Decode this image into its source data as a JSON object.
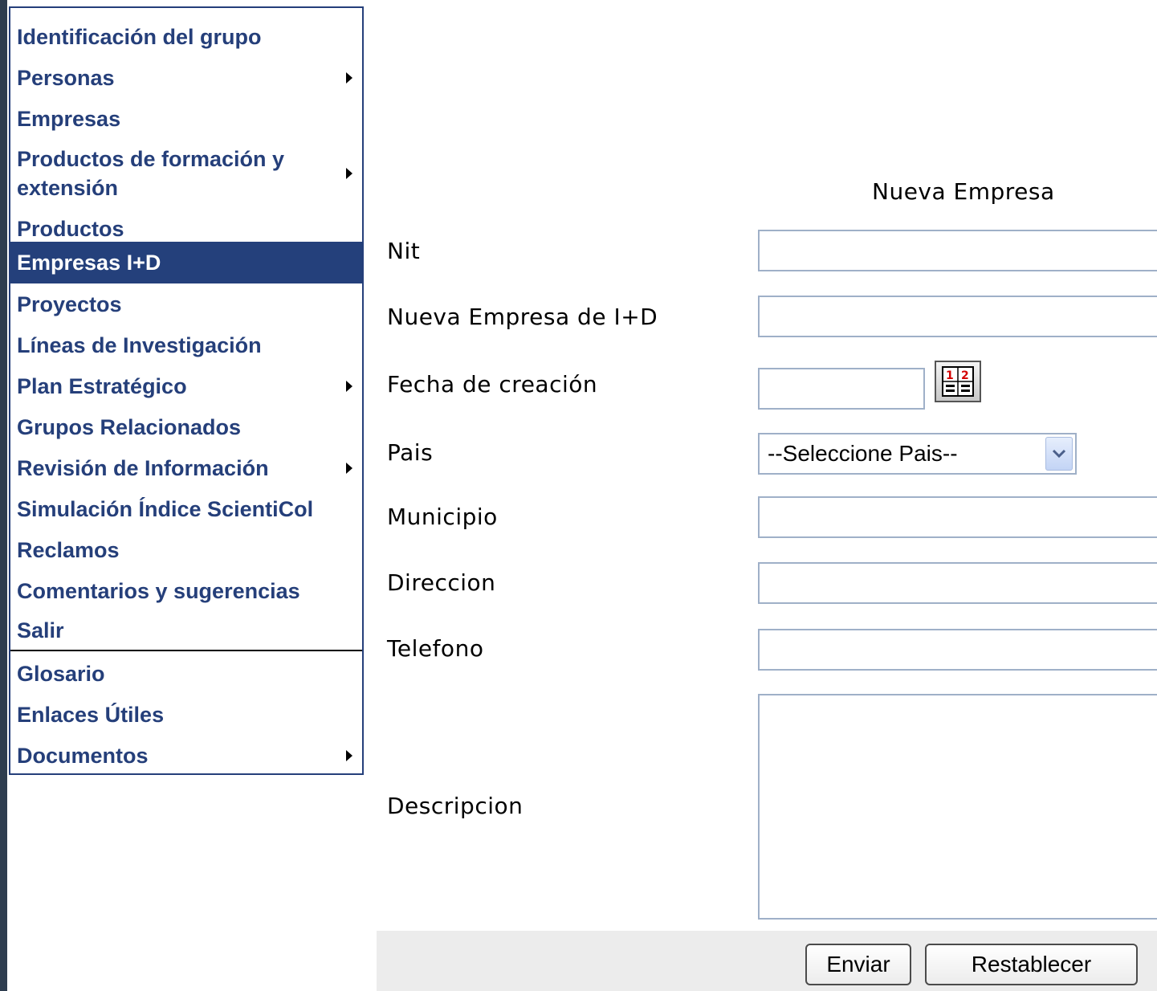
{
  "menu": {
    "items": [
      {
        "label": "Identificación del grupo"
      },
      {
        "label": "Personas"
      },
      {
        "label": "Empresas"
      },
      {
        "label": "Productos de formación y extensión"
      },
      {
        "label": "Productos"
      },
      {
        "label": "Empresas I+D"
      },
      {
        "label": "Proyectos"
      },
      {
        "label": "Líneas de Investigación"
      },
      {
        "label": "Plan Estratégico"
      },
      {
        "label": "Grupos Relacionados"
      },
      {
        "label": "Revisión de Información"
      },
      {
        "label": "Simulación Índice ScientiCol"
      },
      {
        "label": "Reclamos"
      },
      {
        "label": "Comentarios y sugerencias"
      },
      {
        "label": "Salir"
      },
      {
        "label": "Glosario"
      },
      {
        "label": "Enlaces Útiles"
      },
      {
        "label": "Documentos"
      }
    ],
    "active_item": "Empresas I+D"
  },
  "form": {
    "title": "Nueva Empresa",
    "labels": {
      "nit": "Nit",
      "empresa": "Nueva Empresa de I+D",
      "fecha": "Fecha de creación",
      "pais": "Pais",
      "municipio": "Municipio",
      "direccion": "Direccion",
      "telefono": "Telefono",
      "descripcion": "Descripcion"
    },
    "values": {
      "nit": "",
      "empresa": "",
      "fecha": "",
      "municipio": "",
      "direccion": "",
      "telefono": "",
      "descripcion": ""
    },
    "pais_selected": "--Seleccione Pais--",
    "buttons": {
      "submit": "Enviar",
      "reset": "Restablecer"
    }
  },
  "icons": {
    "submenu": "triangle-right-icon",
    "calendar": "calendar-icon",
    "dropdown": "chevron-down-icon"
  },
  "colors": {
    "menu_text": "#253f7a",
    "menu_active_bg": "#24407b",
    "input_border": "#9fb0c8"
  }
}
